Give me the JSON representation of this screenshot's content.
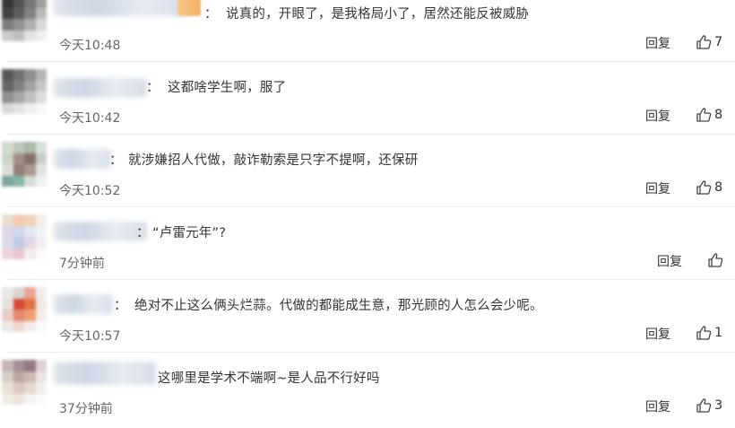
{
  "colon": "：",
  "reply_label": "回复",
  "comments": [
    {
      "text": "说真的，开眼了，是我格局小了，居然还能反被威胁",
      "time": "今天10:48",
      "likes": "7"
    },
    {
      "text": "这都啥学生啊，服了",
      "time": "今天10:42",
      "likes": "8"
    },
    {
      "text": "就涉嫌招人代做，敲诈勒索是只字不提啊，还保研",
      "time": "今天10:52",
      "likes": "8"
    },
    {
      "text": "“卢雷元年”?",
      "time": "7分钟前",
      "likes": ""
    },
    {
      "text": "绝对不止这么俩头烂蒜。代做的都能成生意，那光顾的人怎么会少呢。",
      "time": "今天10:57",
      "likes": "1"
    },
    {
      "text": "这哪里是学术不端啊~是人品不行好吗",
      "time": "37分钟前",
      "likes": "3"
    }
  ],
  "colors": {
    "divider": "#ececec",
    "text": "#333333",
    "time": "#666666"
  }
}
